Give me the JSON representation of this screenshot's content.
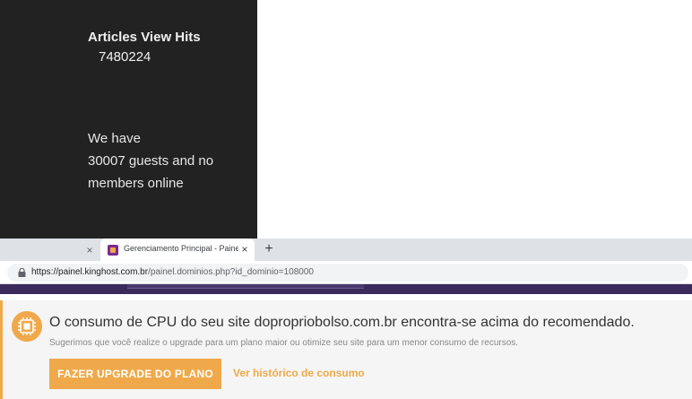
{
  "site": {
    "stats_title": "Articles View Hits",
    "stats_value": "7480224",
    "online_line1": "We have",
    "online_line2": "30007 guests and no",
    "online_line3": "members online"
  },
  "browser": {
    "prev_tab_close": "×",
    "active_tab_title": "Gerenciamento Principal - Painel",
    "active_tab_close": "×",
    "new_tab": "+",
    "url_host": "https://painel.kinghost.com.br",
    "url_path": "/painel.dominios.php?id_dominio=108000"
  },
  "alert": {
    "title": "O consumo de CPU do seu site dopropriobolso.com.br encontra-se acima do recomendado.",
    "subtitle": "Sugerimos que você realize o upgrade para um plano maior ou otimize seu site para um menor consumo de recursos.",
    "upgrade_button": "FAZER UPGRADE DO PLANO",
    "history_link": "Ver histórico de consumo"
  },
  "colors": {
    "accent": "#f0a94a",
    "dark_panel": "#222222",
    "purple_bar": "#3b2b5c"
  },
  "icons": {
    "favicon": "kinghost-favicon",
    "lock": "lock-icon",
    "alert": "cpu-chip-icon"
  }
}
